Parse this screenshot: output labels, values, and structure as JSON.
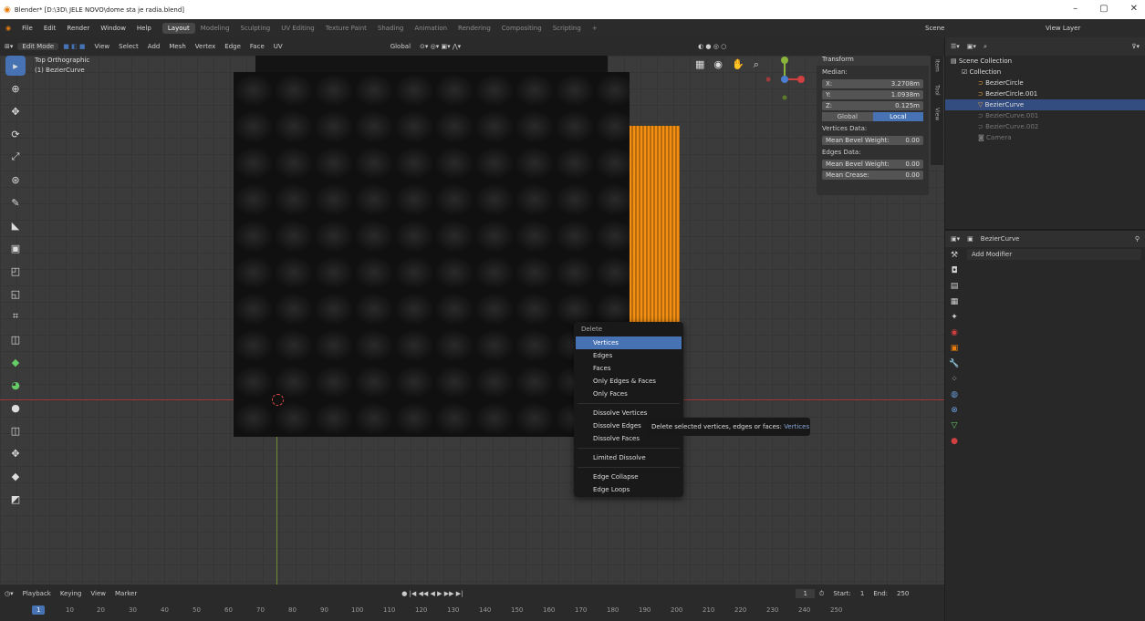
{
  "title": "Blender* [D:\\3D\\ JELE NOVO\\dome sta je radia.blend]",
  "menus": [
    "File",
    "Edit",
    "Render",
    "Window",
    "Help"
  ],
  "workspace_tabs": [
    "Layout",
    "Modeling",
    "Sculpting",
    "UV Editing",
    "Texture Paint",
    "Shading",
    "Animation",
    "Rendering",
    "Compositing",
    "Scripting"
  ],
  "active_tab": "Layout",
  "top_right": {
    "scene": "Scene",
    "view_layer": "View Layer"
  },
  "header": {
    "mode": "Edit Mode",
    "items": [
      "View",
      "Select",
      "Add",
      "Mesh",
      "Vertex",
      "Edge",
      "Face",
      "UV"
    ],
    "transform": "Global"
  },
  "viewport": {
    "view": "Top Orthographic",
    "object": "(1) BezierCurve"
  },
  "npanel": {
    "title": "Transform",
    "median": "Median:",
    "x_label": "X:",
    "x": "3.2708m",
    "y_label": "Y:",
    "y": "1.0938m",
    "z_label": "Z:",
    "z": "0.125m",
    "global": "Global",
    "local": "Local",
    "vertices_data": "Vertices Data:",
    "mean_bevel_weight": "Mean Bevel Weight:",
    "vbw": "0.00",
    "edges_data": "Edges Data:",
    "ebw": "0.00",
    "mean_crease": "Mean Crease:",
    "crease": "0.00"
  },
  "side_tabs": [
    "Item",
    "Tool",
    "View"
  ],
  "delete_menu": {
    "title": "Delete",
    "items": [
      "Vertices",
      "Edges",
      "Faces",
      "Only Edges & Faces",
      "Only Faces",
      "Dissolve Vertices",
      "Dissolve Edges",
      "Dissolve Faces",
      "Limited Dissolve",
      "Edge Collapse",
      "Edge Loops"
    ]
  },
  "tooltip": {
    "text": "Delete selected vertices, edges or faces:",
    "value": "Vertices"
  },
  "timeline": {
    "items": [
      "Playback",
      "Keying",
      "View",
      "Marker"
    ],
    "frame": "1",
    "start_label": "Start:",
    "start": "1",
    "end_label": "End:",
    "end": "250",
    "current": "1",
    "ticks": [
      "10",
      "20",
      "30",
      "40",
      "50",
      "60",
      "70",
      "80",
      "90",
      "100",
      "110",
      "120",
      "130",
      "140",
      "150",
      "160",
      "170",
      "180",
      "190",
      "200",
      "210",
      "220",
      "230",
      "240",
      "250"
    ]
  },
  "outliner": {
    "root": "Scene Collection",
    "collection": "Collection",
    "items": [
      "BezierCircle",
      "BezierCircle.001",
      "BezierCurve",
      "BezierCurve.001",
      "BezierCurve.002",
      "Camera"
    ]
  },
  "properties": {
    "object": "BezierCurve",
    "add_modifier": "Add Modifier"
  }
}
